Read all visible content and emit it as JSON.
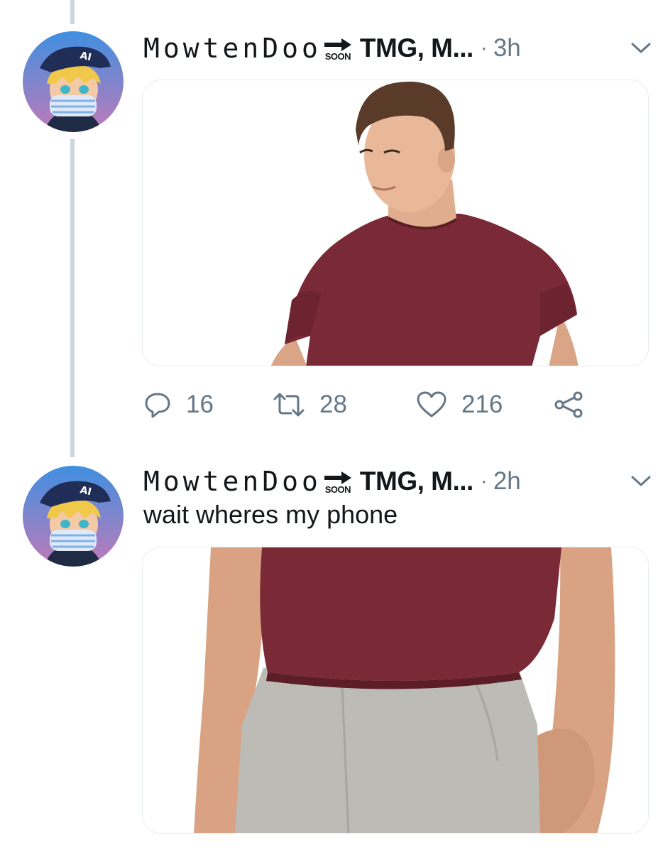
{
  "tweets": [
    {
      "display_name": "MowtenDoo",
      "badge_label": "SOON",
      "handle": "TMG, M...",
      "separator": "·",
      "time": "3h",
      "text": "",
      "stats": {
        "replies": "16",
        "retweets": "28",
        "likes": "216"
      }
    },
    {
      "display_name": "MowtenDoo",
      "badge_label": "SOON",
      "handle": "TMG, M...",
      "separator": "·",
      "time": "2h",
      "text": "wait wheres my phone"
    }
  ],
  "icons": {
    "reply": "reply-icon",
    "retweet": "retweet-icon",
    "like": "heart-icon",
    "share": "share-icon",
    "menu": "chevron-down-icon",
    "badge": "arrow-right-icon"
  },
  "colors": {
    "text": "#14171a",
    "secondary": "#657786",
    "thread_line": "#ccd6dd",
    "border": "#e6ecf0",
    "shirt": "#7a2a36",
    "pants": "#bdbbb6"
  }
}
